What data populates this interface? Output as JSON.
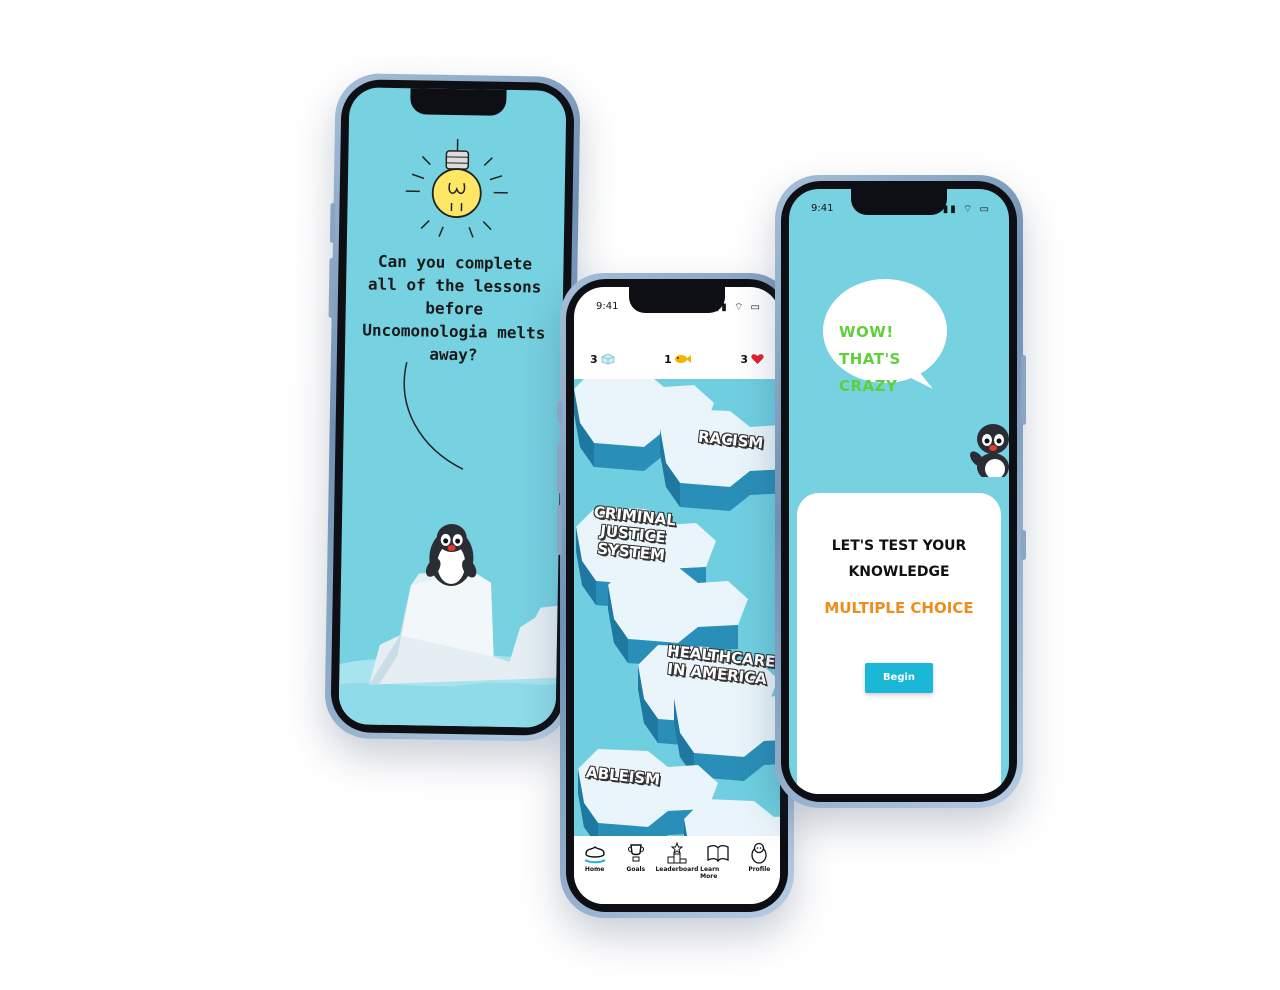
{
  "left_screen": {
    "question": "Can you complete all of the lessons before Uncomonologia melts away?"
  },
  "middle_screen": {
    "status_time": "9:41",
    "status_icons": "▮▮ ⌔ ▭",
    "hud": {
      "ice_count": "3",
      "fish_count": "1",
      "hearts_count": "3"
    },
    "lessons": [
      {
        "label": "RACISM"
      },
      {
        "label": "CRIMINAL JUSTICE SYSTEM"
      },
      {
        "label": "HEALTHCARE IN AMERICA"
      },
      {
        "label": "ABLEISM"
      }
    ],
    "nav": [
      {
        "label": "Home",
        "icon": "home-iceberg-icon"
      },
      {
        "label": "Goals",
        "icon": "trophy-icon"
      },
      {
        "label": "Leaderboard",
        "icon": "podium-icon"
      },
      {
        "label": "Learn More",
        "icon": "book-icon"
      },
      {
        "label": "Profile",
        "icon": "penguin-icon"
      }
    ]
  },
  "right_screen": {
    "status_time": "9:41",
    "status_icons": "▮▮ ⌔ ▭",
    "bubble_line1": "WOW! THAT'S",
    "bubble_line2": "CRAZY",
    "card_title": "LET'S TEST YOUR KNOWLEDGE",
    "card_subtitle": "MULTIPLE CHOICE",
    "begin_label": "Begin"
  },
  "colors": {
    "sky": "#76d1e0",
    "water": "#6fcfe0",
    "accent_green": "#5fcf3b",
    "accent_orange": "#f08c1a",
    "button": "#1bb7d6"
  }
}
